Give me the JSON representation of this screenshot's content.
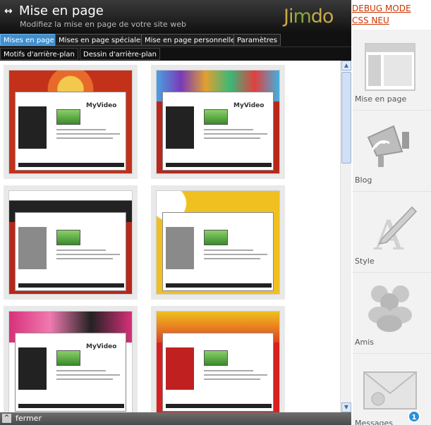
{
  "header": {
    "title": "Mise en page",
    "subtitle": "Modifiez la mise en page de votre site web",
    "logo": "Jimdo"
  },
  "tabs": [
    {
      "label": "Mises en page",
      "active": true
    },
    {
      "label": "Mises en page spéciales",
      "active": false
    },
    {
      "label": "Mise en page personnelle",
      "active": false
    },
    {
      "label": "Paramètres",
      "active": false
    }
  ],
  "subtabs": [
    {
      "label": "Motifs d'arrière-plan"
    },
    {
      "label": "Dessin d'arrière-plan"
    }
  ],
  "layouts": [
    {
      "brand": "MyVideo",
      "bg": "#c4311a",
      "top": "#e8d8a0"
    },
    {
      "brand": "MyVideo",
      "bg": "#b8281a",
      "top": "#3aa0e0"
    },
    {
      "brand": "",
      "bg": "#b8281a",
      "top": "#2a2a2a"
    },
    {
      "brand": "",
      "bg": "#f0c020",
      "top": "#f0c020"
    },
    {
      "brand": "MyVideo",
      "bg": "#ffffff",
      "top": "#d8307a"
    },
    {
      "brand": "",
      "bg": "#d82020",
      "top": "#f0c020"
    }
  ],
  "footer": {
    "label": "fermer"
  },
  "links": {
    "debug": "DEBUG MODE",
    "css": "CSS NEU"
  },
  "sidebar": {
    "items": [
      {
        "label": "Mise en page",
        "icon": "layout-icon"
      },
      {
        "label": "Blog",
        "icon": "megaphone-icon"
      },
      {
        "label": "Style",
        "icon": "pen-icon"
      },
      {
        "label": "Amis",
        "icon": "friends-icon"
      },
      {
        "label": "Messages",
        "icon": "envelope-icon"
      }
    ]
  },
  "messages_badge": "1",
  "colors": {
    "accent": "#3f8fcf",
    "header": "#1a1a1a",
    "link": "#cc3300"
  }
}
